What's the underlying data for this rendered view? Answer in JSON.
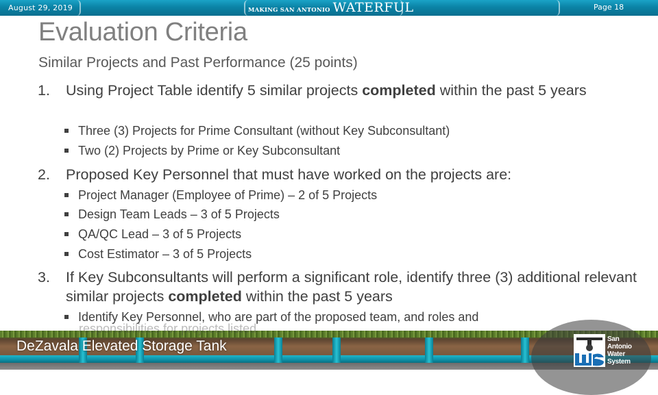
{
  "header": {
    "date": "August 29, 2019",
    "brand_small": "MAKING SAN ANTONIO",
    "brand_big": "WATERFUL",
    "page": "Page 18"
  },
  "slide": {
    "title": "Evaluation Criteria",
    "subtitle": "Similar Projects and Past Performance (25 points)",
    "items": [
      {
        "number": "1.",
        "text_before": "Using Project Table identify 5 similar projects ",
        "text_bold": "completed",
        "text_after": " within the past 5 years",
        "bullets": [
          "Three (3) Projects for Prime Consultant (without Key Subconsultant)",
          "Two (2) Projects by Prime or Key Subconsultant"
        ]
      },
      {
        "number": "2.",
        "text": "Proposed Key Personnel that must have worked on the projects are:",
        "bullets": [
          "Project Manager (Employee of Prime) – 2 of 5 Projects",
          "Design Team Leads – 3 of 5 Projects",
          "QA/QC Lead – 3 of 5 Projects",
          "Cost Estimator – 3 of 5 Projects"
        ]
      },
      {
        "number": "3.",
        "text_before": "If Key Subconsultants will perform a significant role, identify three (3) additional relevant similar projects ",
        "text_bold": "completed",
        "text_after": " within the past 5 years",
        "bullets": [
          "Identify Key Personnel, who are part of the proposed team, and roles and",
          "responsibilities for projects listed"
        ]
      }
    ]
  },
  "footer": {
    "caption": "DeZavala Elevated Storage Tank",
    "logo_text": [
      "San",
      "Antonio",
      "Water",
      "System"
    ]
  },
  "colors": {
    "banner": "#0b83a6",
    "title": "#808080",
    "body_text": "#404040",
    "pipe": "#1fb6c9"
  }
}
